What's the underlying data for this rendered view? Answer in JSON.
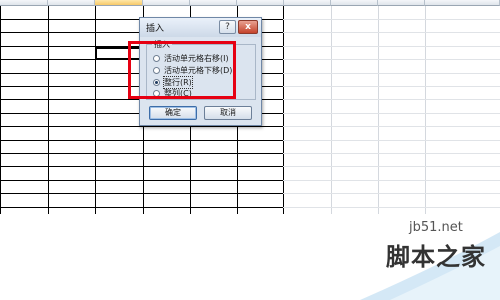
{
  "dialog": {
    "title": "插入",
    "help_button": "?",
    "close_button": "x",
    "group_label": "插入",
    "options": [
      {
        "label": "活动单元格右移(I)",
        "checked": false
      },
      {
        "label": "活动单元格下移(D)",
        "checked": false
      },
      {
        "label": "整行(R)",
        "checked": true
      },
      {
        "label": "整列(C)",
        "checked": false
      }
    ],
    "ok_label": "确定",
    "cancel_label": "取消"
  },
  "watermark": {
    "url": "jb51.net",
    "name": "脚本之家"
  },
  "colors": {
    "highlight": "#e60012",
    "dialog_bg": "#dbe4ef",
    "grid_line": "#000000"
  }
}
